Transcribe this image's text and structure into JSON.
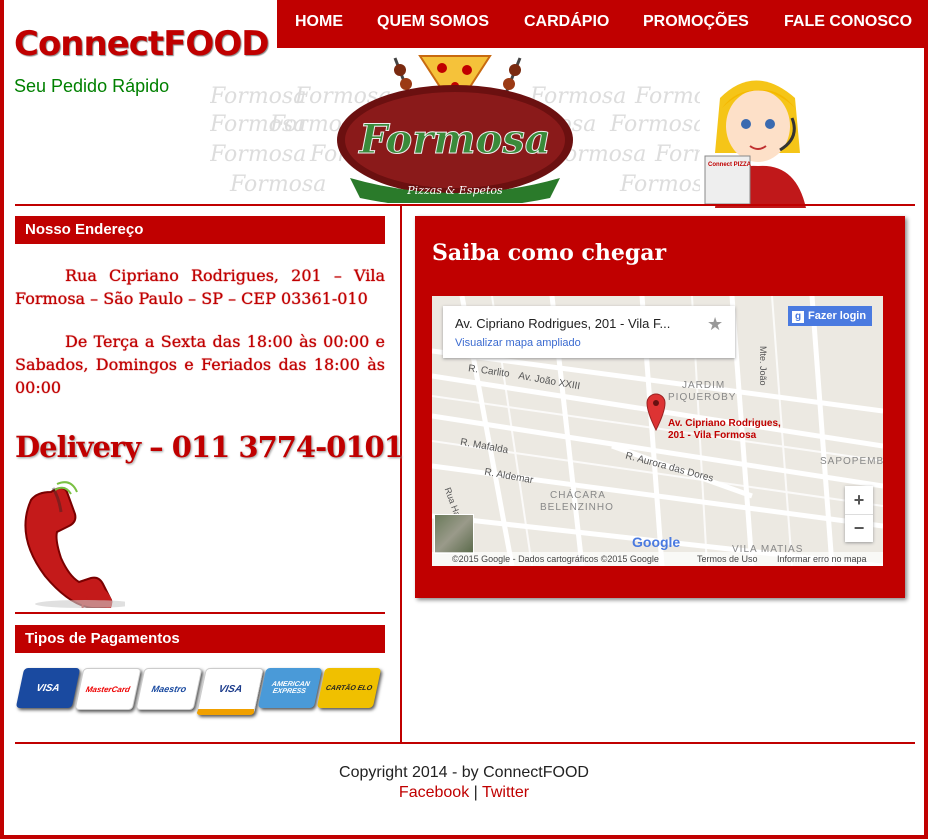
{
  "header": {
    "brand": "ConnectFOOD",
    "tagline": "Seu Pedido Rápido",
    "banner_word": "Formosa",
    "banner_logo": "Formosa",
    "banner_sub": "Pizzas & Espetos",
    "mascot_screen": "Connect PIZZA"
  },
  "nav": {
    "items": [
      "HOME",
      "QUEM SOMOS",
      "CARDÁPIO",
      "PROMOÇÕES",
      "FALE CONOSCO"
    ]
  },
  "address": {
    "heading": "Nosso Endereço",
    "street": "Rua Cipriano Rodrigues, 201 – Vila Formosa – São Paulo – SP – CEP 03361-010",
    "hours": "De Terça a Sexta das 18:00 às 00:00 e Sabados, Domingos e Feriados das 18:00 às 00:00",
    "delivery": "Delivery – 011 3774-0101"
  },
  "payments": {
    "heading": "Tipos de Pagamentos",
    "cards": [
      "VISA",
      "MasterCard",
      "Maestro",
      "VISA",
      "AMERICAN EXPRESS",
      "CARTÃO ELO"
    ]
  },
  "map": {
    "heading": "Saiba como chegar",
    "place_title": "Av. Cipriano Rodrigues, 201 - Vila F...",
    "place_link": "Visualizar mapa ampliado",
    "login": "Fazer login",
    "marker_label_1": "Av. Cipriano Rodrigues,",
    "marker_label_2": "201 - Vila Formosa",
    "zoom_in": "+",
    "zoom_out": "−",
    "google": "Google",
    "attribution": "©2015 Google - Dados cartográficos ©2015 Google",
    "terms": "Termos de Uso",
    "report": "Informar erro no mapa",
    "streets": {
      "carlito": "R. Carlito",
      "joao": "Av. João XXIII",
      "jardim": "JARDIM",
      "piqueroby": "PIQUEROBY",
      "mafalda": "R. Mafalda",
      "aldemar": "R. Aldemar",
      "aurora": "R. Aurora das Dores",
      "chacara": "CHÁCARA",
      "belenzinho": "BELENZINHO",
      "sapopemba": "SAPOPEMBA",
      "vila_matias": "VILA MATIAS",
      "mte_joao": "Mte. João",
      "rua_hamilton": "Rua Hamilton"
    }
  },
  "footer": {
    "copyright": "Copyright 2014 - by ConnectFOOD",
    "facebook": "Facebook",
    "separator": "|",
    "twitter": "Twitter"
  },
  "colors": {
    "brand_red": "#c00000",
    "tagline_green": "#008000"
  }
}
